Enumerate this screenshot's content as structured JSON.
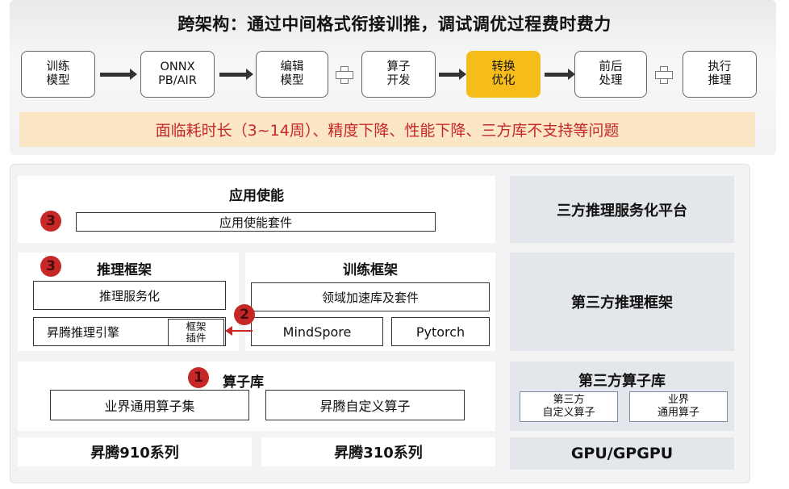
{
  "headline": "跨架构：通过中间格式衔接训推，调试调优过程费时费力",
  "flow": {
    "steps": [
      {
        "line1": "训练",
        "line2": "模型"
      },
      {
        "line1": "ONNX",
        "line2": "PB/AIR"
      },
      {
        "line1": "编辑",
        "line2": "模型"
      },
      {
        "line1": "算子",
        "line2": "开发"
      },
      {
        "line1": "转换",
        "line2": "优化"
      },
      {
        "line1": "前后",
        "line2": "处理"
      },
      {
        "line1": "执行",
        "line2": "推理"
      }
    ],
    "highlight_color": "#f6bd1a"
  },
  "problem": "面临耗时长（3~14周）、精度下降、性能下降、三方库不支持等问题",
  "ascend": {
    "app_enable": {
      "title": "应用使能",
      "badge": "3",
      "kit": "应用使能套件"
    },
    "inference": {
      "title": "推理框架",
      "badge": "3",
      "serving": "推理服务化",
      "engine": "昇腾推理引擎",
      "plugin_line1": "框架",
      "plugin_line2": "插件"
    },
    "training": {
      "title": "训练框架",
      "badge": "2",
      "domain_kit": "领域加速库及套件",
      "mindspore": "MindSpore",
      "pytorch": "Pytorch"
    },
    "operators": {
      "title": "算子库",
      "badge": "1",
      "common_ops": "业界通用算子集",
      "custom_ops": "昇腾自定义算子"
    },
    "hw910": "昇腾910系列",
    "hw310": "昇腾310系列"
  },
  "third_party": {
    "serving_platform": "三方推理服务化平台",
    "inference_framework": "第三方推理框架",
    "operator_lib": {
      "title": "第三方算子库",
      "custom_line1": "第三方",
      "custom_line2": "自定义算子",
      "common_line1": "业界",
      "common_line2": "通用算子"
    },
    "hardware": "GPU/GPGPU"
  },
  "colors": {
    "badge": "#c62828",
    "problem_text": "#c62828",
    "problem_bg": "#fbe7c5"
  }
}
